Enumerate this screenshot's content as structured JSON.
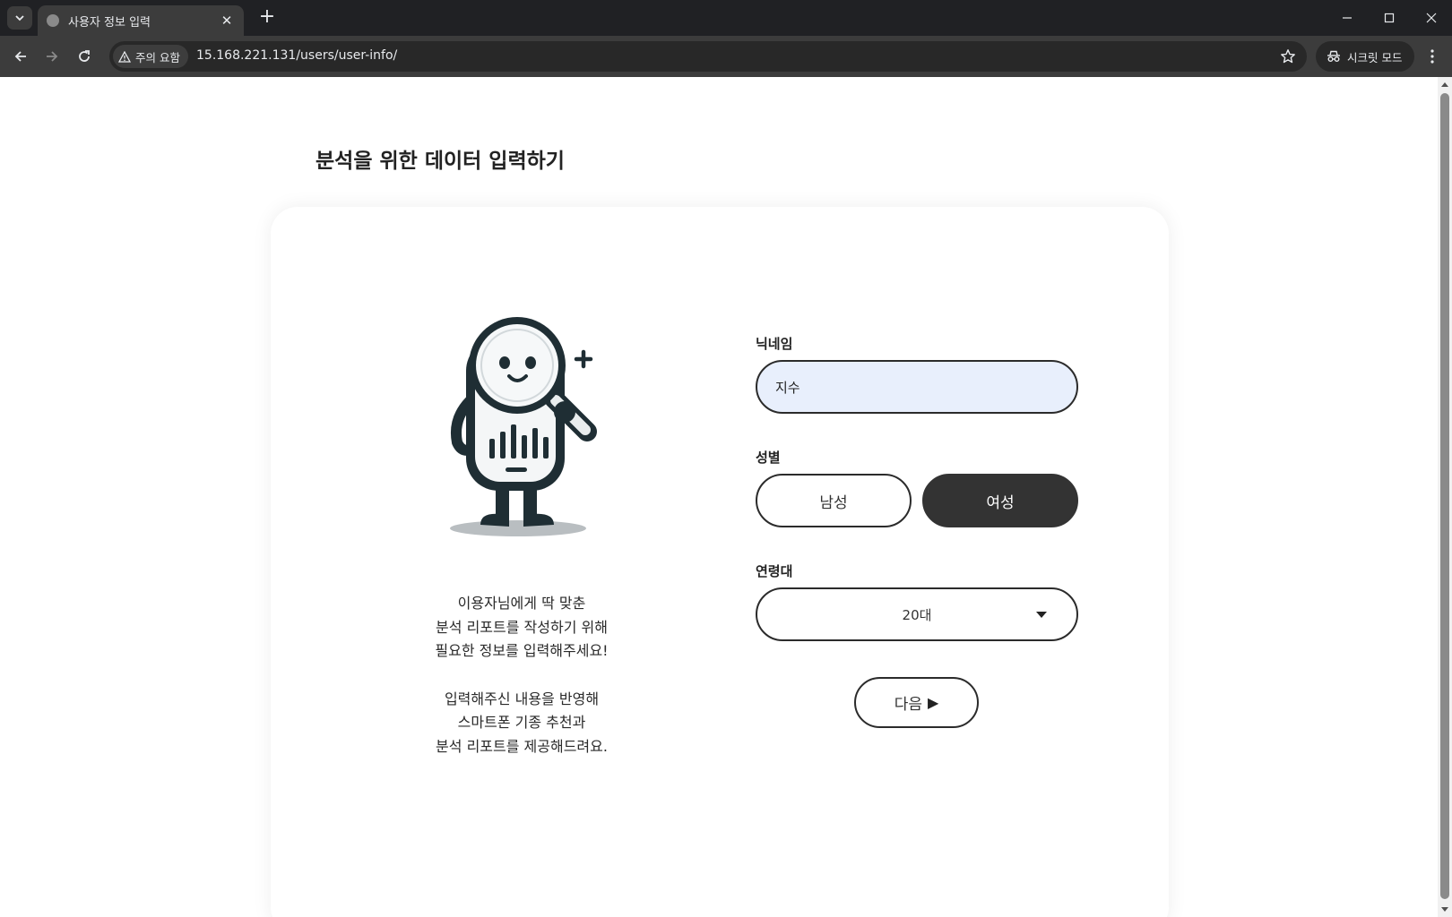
{
  "browser": {
    "tab_title": "사용자 정보 입력",
    "security_label": "주의 요함",
    "url": "15.168.221.131/users/user-info/",
    "incognito_label": "시크릿 모드"
  },
  "page": {
    "title": "분석을 위한 데이터 입력하기",
    "intro_lines": [
      "이용자님에게 딱 맞춘",
      "분석 리포트를 작성하기 위해",
      "필요한 정보를 입력해주세요!",
      "입력해주신 내용을 반영해",
      "스마트폰 기종 추천과",
      "분석 리포트를 제공해드려요."
    ]
  },
  "form": {
    "nickname_label": "닉네임",
    "nickname_value": "지수",
    "gender_label": "성별",
    "gender_male": "남성",
    "gender_female": "여성",
    "gender_selected": "여성",
    "age_label": "연령대",
    "age_value": "20대",
    "next_label": "다음",
    "next_arrow": "▶"
  },
  "colors": {
    "selected_button": "#333333",
    "input_fill": "#e8effc",
    "mascot_dark": "#1f2e34"
  }
}
